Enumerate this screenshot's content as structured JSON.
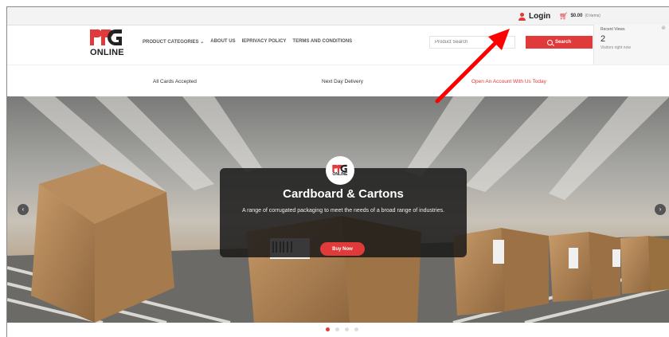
{
  "topbar": {
    "login_label": "Login",
    "cart_total": "$0.00",
    "cart_items": "(0 items)"
  },
  "recently_viewed": {
    "title": "Recent Views",
    "close": "⊗",
    "count": "2",
    "subtitle": "Visitors right now"
  },
  "header": {
    "logo_text": "ONLINE",
    "nav": [
      {
        "label": "PRODUCT CATEGORIES ⌄"
      },
      {
        "label": "ABOUT US"
      },
      {
        "label": "IEPRIVACY POLICY"
      },
      {
        "label": "TERMS AND CONDITIONS"
      }
    ],
    "search_placeholder": "Product Search",
    "search_button": "Search"
  },
  "usp": {
    "item1": "All Cards Accepted",
    "item2": "Next Day Delivery",
    "item3": "Open An Account With Us Today"
  },
  "hero": {
    "logo_text": "ONLINE",
    "title": "Cardboard & Cartons",
    "description": "A range of corrugated packaging to meet the needs of a broad range of industries.",
    "button": "Buy Now",
    "prev_arrow": "‹",
    "next_arrow": "›",
    "slides": 4,
    "active_slide": 1
  },
  "colors": {
    "accent": "#e03a3a",
    "annotation_arrow": "#ff0000",
    "caption_bg": "#191919"
  }
}
